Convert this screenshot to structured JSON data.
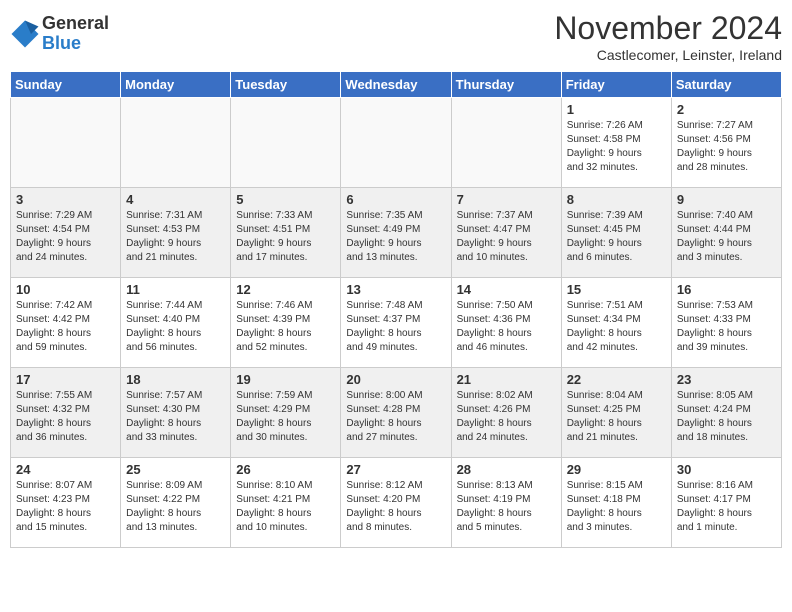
{
  "logo": {
    "general": "General",
    "blue": "Blue"
  },
  "title": "November 2024",
  "subtitle": "Castlecomer, Leinster, Ireland",
  "days_of_week": [
    "Sunday",
    "Monday",
    "Tuesday",
    "Wednesday",
    "Thursday",
    "Friday",
    "Saturday"
  ],
  "weeks": [
    [
      {
        "day": "",
        "info": ""
      },
      {
        "day": "",
        "info": ""
      },
      {
        "day": "",
        "info": ""
      },
      {
        "day": "",
        "info": ""
      },
      {
        "day": "",
        "info": ""
      },
      {
        "day": "1",
        "info": "Sunrise: 7:26 AM\nSunset: 4:58 PM\nDaylight: 9 hours\nand 32 minutes."
      },
      {
        "day": "2",
        "info": "Sunrise: 7:27 AM\nSunset: 4:56 PM\nDaylight: 9 hours\nand 28 minutes."
      }
    ],
    [
      {
        "day": "3",
        "info": "Sunrise: 7:29 AM\nSunset: 4:54 PM\nDaylight: 9 hours\nand 24 minutes."
      },
      {
        "day": "4",
        "info": "Sunrise: 7:31 AM\nSunset: 4:53 PM\nDaylight: 9 hours\nand 21 minutes."
      },
      {
        "day": "5",
        "info": "Sunrise: 7:33 AM\nSunset: 4:51 PM\nDaylight: 9 hours\nand 17 minutes."
      },
      {
        "day": "6",
        "info": "Sunrise: 7:35 AM\nSunset: 4:49 PM\nDaylight: 9 hours\nand 13 minutes."
      },
      {
        "day": "7",
        "info": "Sunrise: 7:37 AM\nSunset: 4:47 PM\nDaylight: 9 hours\nand 10 minutes."
      },
      {
        "day": "8",
        "info": "Sunrise: 7:39 AM\nSunset: 4:45 PM\nDaylight: 9 hours\nand 6 minutes."
      },
      {
        "day": "9",
        "info": "Sunrise: 7:40 AM\nSunset: 4:44 PM\nDaylight: 9 hours\nand 3 minutes."
      }
    ],
    [
      {
        "day": "10",
        "info": "Sunrise: 7:42 AM\nSunset: 4:42 PM\nDaylight: 8 hours\nand 59 minutes."
      },
      {
        "day": "11",
        "info": "Sunrise: 7:44 AM\nSunset: 4:40 PM\nDaylight: 8 hours\nand 56 minutes."
      },
      {
        "day": "12",
        "info": "Sunrise: 7:46 AM\nSunset: 4:39 PM\nDaylight: 8 hours\nand 52 minutes."
      },
      {
        "day": "13",
        "info": "Sunrise: 7:48 AM\nSunset: 4:37 PM\nDaylight: 8 hours\nand 49 minutes."
      },
      {
        "day": "14",
        "info": "Sunrise: 7:50 AM\nSunset: 4:36 PM\nDaylight: 8 hours\nand 46 minutes."
      },
      {
        "day": "15",
        "info": "Sunrise: 7:51 AM\nSunset: 4:34 PM\nDaylight: 8 hours\nand 42 minutes."
      },
      {
        "day": "16",
        "info": "Sunrise: 7:53 AM\nSunset: 4:33 PM\nDaylight: 8 hours\nand 39 minutes."
      }
    ],
    [
      {
        "day": "17",
        "info": "Sunrise: 7:55 AM\nSunset: 4:32 PM\nDaylight: 8 hours\nand 36 minutes."
      },
      {
        "day": "18",
        "info": "Sunrise: 7:57 AM\nSunset: 4:30 PM\nDaylight: 8 hours\nand 33 minutes."
      },
      {
        "day": "19",
        "info": "Sunrise: 7:59 AM\nSunset: 4:29 PM\nDaylight: 8 hours\nand 30 minutes."
      },
      {
        "day": "20",
        "info": "Sunrise: 8:00 AM\nSunset: 4:28 PM\nDaylight: 8 hours\nand 27 minutes."
      },
      {
        "day": "21",
        "info": "Sunrise: 8:02 AM\nSunset: 4:26 PM\nDaylight: 8 hours\nand 24 minutes."
      },
      {
        "day": "22",
        "info": "Sunrise: 8:04 AM\nSunset: 4:25 PM\nDaylight: 8 hours\nand 21 minutes."
      },
      {
        "day": "23",
        "info": "Sunrise: 8:05 AM\nSunset: 4:24 PM\nDaylight: 8 hours\nand 18 minutes."
      }
    ],
    [
      {
        "day": "24",
        "info": "Sunrise: 8:07 AM\nSunset: 4:23 PM\nDaylight: 8 hours\nand 15 minutes."
      },
      {
        "day": "25",
        "info": "Sunrise: 8:09 AM\nSunset: 4:22 PM\nDaylight: 8 hours\nand 13 minutes."
      },
      {
        "day": "26",
        "info": "Sunrise: 8:10 AM\nSunset: 4:21 PM\nDaylight: 8 hours\nand 10 minutes."
      },
      {
        "day": "27",
        "info": "Sunrise: 8:12 AM\nSunset: 4:20 PM\nDaylight: 8 hours\nand 8 minutes."
      },
      {
        "day": "28",
        "info": "Sunrise: 8:13 AM\nSunset: 4:19 PM\nDaylight: 8 hours\nand 5 minutes."
      },
      {
        "day": "29",
        "info": "Sunrise: 8:15 AM\nSunset: 4:18 PM\nDaylight: 8 hours\nand 3 minutes."
      },
      {
        "day": "30",
        "info": "Sunrise: 8:16 AM\nSunset: 4:17 PM\nDaylight: 8 hours\nand 1 minute."
      }
    ]
  ]
}
